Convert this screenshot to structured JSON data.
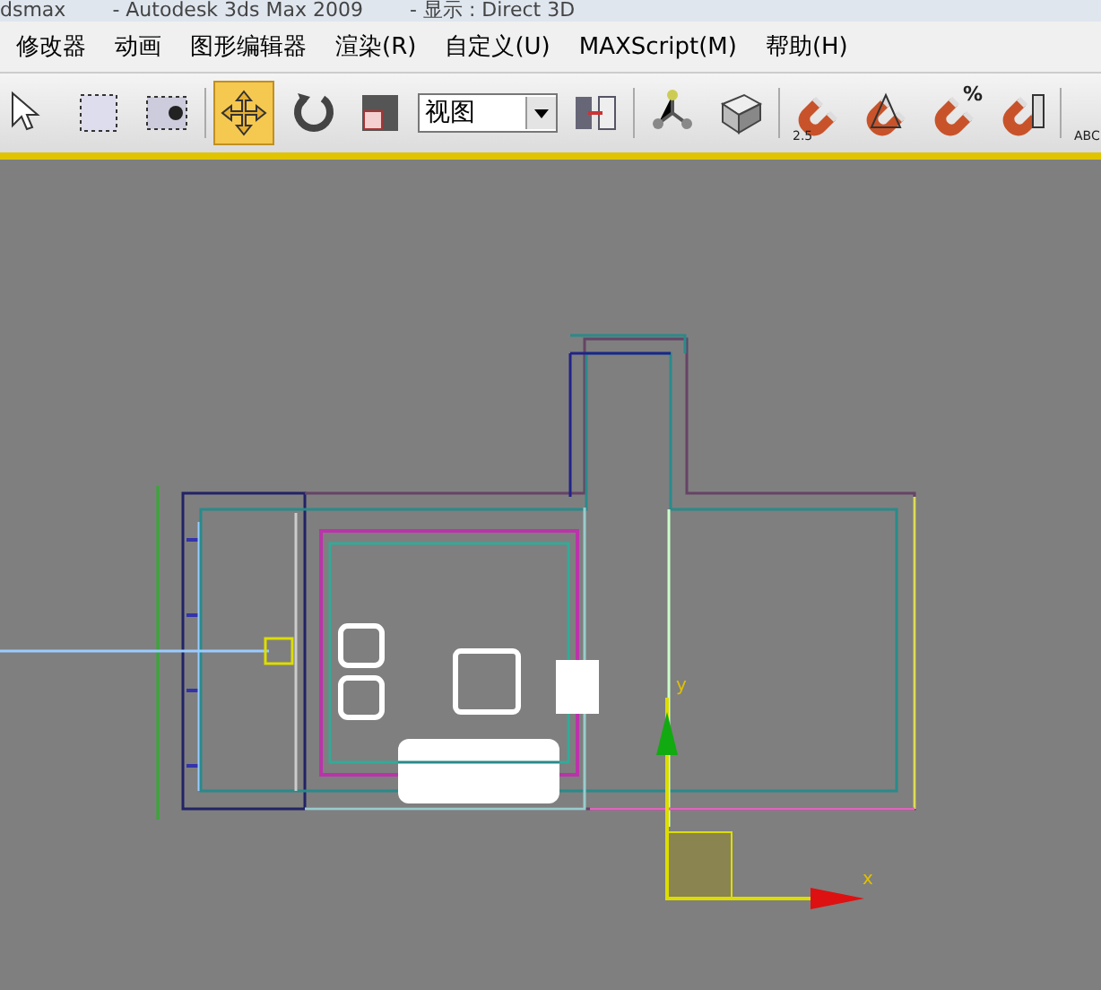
{
  "window": {
    "title_parts": [
      "dsmax",
      "- Autodesk 3ds Max  2009",
      "- 显示 : Direct 3D"
    ]
  },
  "menu": [
    "修改器",
    "动画",
    "图形编辑器",
    "渲染(R)",
    "自定义(U)",
    "MAXScript(M)",
    "帮助(H)"
  ],
  "toolbar": [
    {
      "kind": "tool",
      "selected": false
    },
    {
      "kind": "tool",
      "selected": false
    },
    {
      "kind": "tool",
      "selected": false
    },
    {
      "kind": "separator"
    },
    {
      "kind": "tool",
      "selected": true
    },
    {
      "kind": "tool",
      "selected": false
    },
    {
      "kind": "tool",
      "selected": false
    },
    {
      "kind": "dropdown",
      "value": "视图"
    },
    {
      "kind": "tool",
      "selected": false
    },
    {
      "kind": "separator"
    },
    {
      "kind": "tool",
      "selected": false
    },
    {
      "kind": "tool",
      "selected": false
    },
    {
      "kind": "separator"
    },
    {
      "kind": "snap",
      "label": "2.5"
    },
    {
      "kind": "tool",
      "selected": false
    },
    {
      "kind": "snap",
      "label": "%"
    },
    {
      "kind": "tool",
      "selected": false
    },
    {
      "kind": "separator"
    },
    {
      "kind": "snap",
      "label": "ABC"
    }
  ],
  "viewport": {
    "axis_labels": [
      "y",
      "x"
    ]
  }
}
